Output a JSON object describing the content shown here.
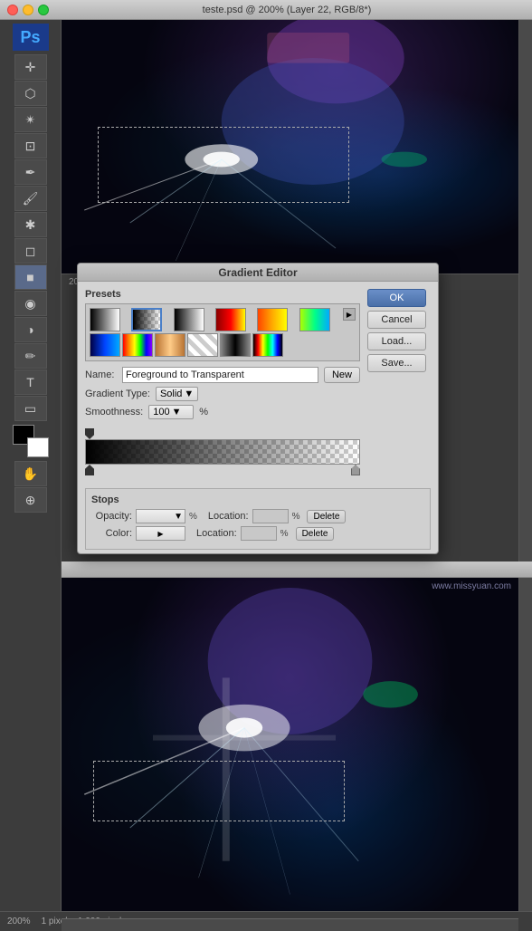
{
  "window": {
    "title": "teste.psd @ 200% (Layer 22, RGB/8*)",
    "traffic_lights": [
      "close",
      "minimize",
      "maximize"
    ]
  },
  "toolbar": {
    "logo": "Ps",
    "tools": [
      "move",
      "lasso",
      "magic-wand",
      "crop",
      "eyedropper",
      "brush",
      "clone-stamp",
      "eraser",
      "gradient",
      "blur",
      "dodge",
      "pen",
      "text",
      "shape",
      "hand",
      "zoom"
    ]
  },
  "status_bar": {
    "zoom": "200%",
    "info": "1 pixel = 1,000 pixels"
  },
  "gradient_editor": {
    "title": "Gradient Editor",
    "presets_label": "Presets",
    "buttons": {
      "ok": "OK",
      "cancel": "Cancel",
      "load": "Load...",
      "save": "Save..."
    },
    "name_label": "Name:",
    "name_value": "Foreground to Transparent",
    "new_btn": "New",
    "gradient_type_label": "Gradient Type:",
    "gradient_type_value": "Solid",
    "smoothness_label": "Smoothness:",
    "smoothness_value": "100",
    "smoothness_unit": "%",
    "stops": {
      "title": "Stops",
      "opacity_label": "Opacity:",
      "opacity_unit": "%",
      "color_label": "Color:",
      "location_label": "Location:",
      "location_unit": "%",
      "delete_btn": "Delete"
    }
  },
  "watermark": "www.missyuan.com",
  "second_window_title": ""
}
